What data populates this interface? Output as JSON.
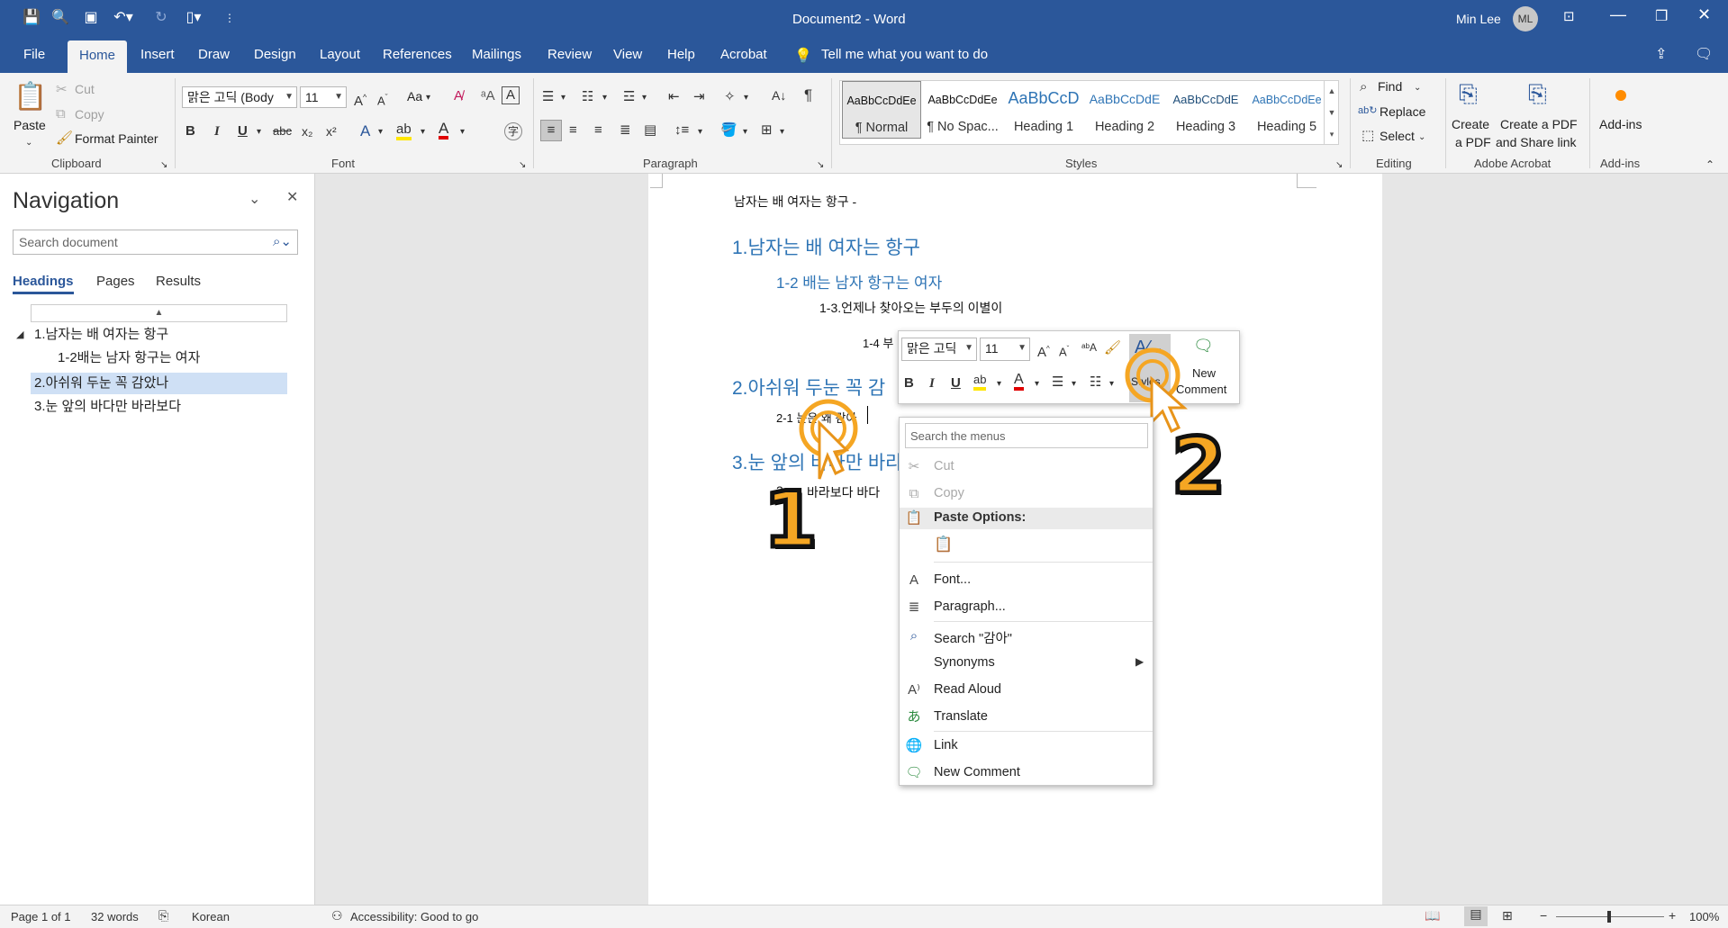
{
  "window": {
    "doc_title": "Document2",
    "app_name": "Word",
    "title_sep": " - ",
    "user_name": "Min Lee",
    "user_initials": "ML"
  },
  "tabs": [
    "File",
    "Home",
    "Insert",
    "Draw",
    "Design",
    "Layout",
    "References",
    "Mailings",
    "Review",
    "View",
    "Help",
    "Acrobat"
  ],
  "tell_me": "Tell me what you want to do",
  "ribbon": {
    "clipboard": {
      "paste": "Paste",
      "cut": "Cut",
      "copy": "Copy",
      "format_painter": "Format Painter",
      "label": "Clipboard"
    },
    "font": {
      "name": "맑은 고딕 (Body",
      "size": "11",
      "case": "Aa",
      "label": "Font"
    },
    "paragraph": {
      "label": "Paragraph"
    },
    "styles": {
      "label": "Styles",
      "items": [
        {
          "sample": "AaBbCcDdEe",
          "name": "¶ Normal"
        },
        {
          "sample": "AaBbCcDdEe",
          "name": "¶ No Spac..."
        },
        {
          "sample": "AaBbCcD",
          "name": "Heading 1"
        },
        {
          "sample": "AaBbCcDdE",
          "name": "Heading 2"
        },
        {
          "sample": "AaBbCcDdE",
          "name": "Heading 3"
        },
        {
          "sample": "AaBbCcDdEe",
          "name": "Heading 5"
        }
      ]
    },
    "editing": {
      "find": "Find",
      "replace": "Replace",
      "select": "Select",
      "label": "Editing"
    },
    "acrobat": {
      "create_pdf_1": "Create",
      "create_pdf_2": "a PDF",
      "share_1": "Create a PDF",
      "share_2": "and Share link",
      "label": "Adobe Acrobat"
    },
    "addins": {
      "btn": "Add-ins",
      "label": "Add-ins"
    }
  },
  "nav": {
    "title": "Navigation",
    "search_placeholder": "Search document",
    "tabs": [
      "Headings",
      "Pages",
      "Results"
    ],
    "items": [
      "1.남자는 배 여자는 항구",
      "1-2배는 남자 항구는 여자",
      "2.아쉬워 두눈 꼭 감았나",
      "3.눈 앞의 바다만 바라보다"
    ]
  },
  "doc": {
    "line0": "남자는 배 여자는 항구 -",
    "h1": "1.남자는 배 여자는 항구",
    "h2": "1-2 배는 남자 항구는 여자",
    "l3": "1-3.언제나 찾아오는 부두의 이별이",
    "l4": "1-4 부",
    "h1b": "2.아쉬워 두눈 꼭 감",
    "l5": "2-1 눈은 왜 감아",
    "h1c": "3.눈 앞의 바다만 바라",
    "l6": "3-",
    "l6b": "바라보다 바다"
  },
  "mini": {
    "font": "맑은 고딕",
    "size": "11",
    "styles": "Styles",
    "new_comment_1": "New",
    "new_comment_2": "Comment"
  },
  "ctx": {
    "search_placeholder": "Search the menus",
    "cut": "Cut",
    "copy": "Copy",
    "paste_options": "Paste Options:",
    "font": "Font...",
    "paragraph": "Paragraph...",
    "search": "Search \"감아\"",
    "synonyms": "Synonyms",
    "read_aloud": "Read Aloud",
    "translate": "Translate",
    "link": "Link",
    "new_comment": "New Comment"
  },
  "status": {
    "page": "Page 1 of 1",
    "words": "32 words",
    "lang": "Korean",
    "accessibility": "Accessibility: Good to go",
    "zoom": "100%"
  },
  "annotations": {
    "one": "1",
    "two": "2"
  },
  "colors": {
    "brand": "#2b579a",
    "heading": "#2e74b5",
    "badge": "#f5a623"
  }
}
